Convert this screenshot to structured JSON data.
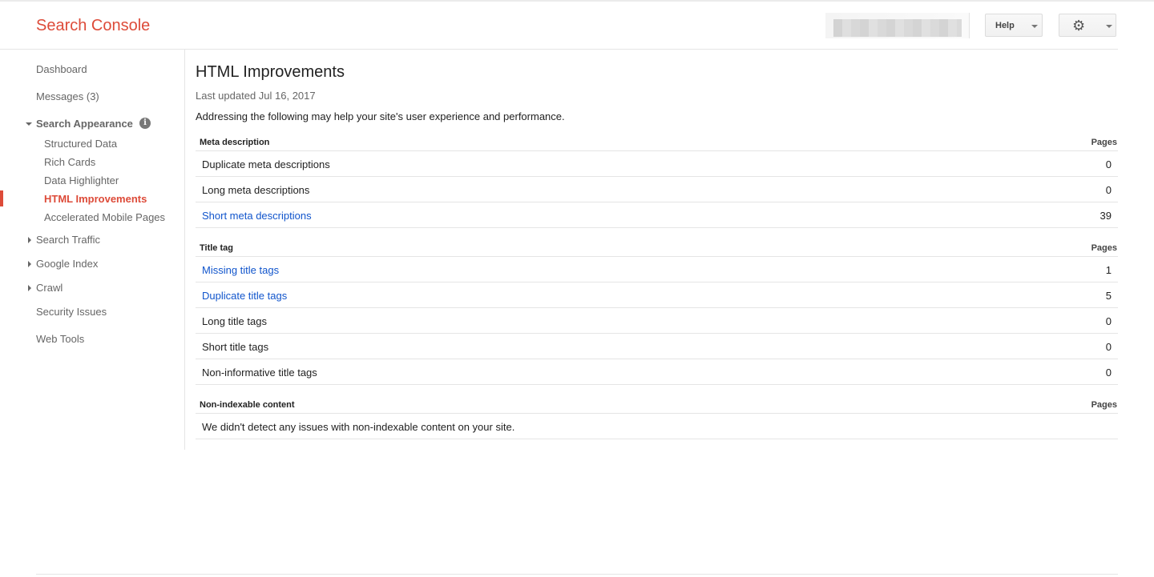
{
  "header": {
    "app_title": "Search Console",
    "account_label": "",
    "help_label": "Help",
    "settings_icon": "gear-icon"
  },
  "sidebar": {
    "items": [
      {
        "label": "Dashboard"
      },
      {
        "label": "Messages (3)"
      },
      {
        "label": "Search Appearance",
        "expanded": true,
        "info_icon": "info-icon"
      },
      {
        "label": "Structured Data"
      },
      {
        "label": "Rich Cards"
      },
      {
        "label": "Data Highlighter"
      },
      {
        "label": "HTML Improvements",
        "active": true
      },
      {
        "label": "Accelerated Mobile Pages"
      },
      {
        "label": "Search Traffic",
        "expanded": false
      },
      {
        "label": "Google Index",
        "expanded": false
      },
      {
        "label": "Crawl",
        "expanded": false
      },
      {
        "label": "Security Issues"
      },
      {
        "label": "Web Tools"
      }
    ],
    "active_color": "#dd4b39"
  },
  "main": {
    "title": "HTML Improvements",
    "last_updated": "Last updated Jul 16, 2017",
    "intro": "Addressing the following may help your site's user experience and performance.",
    "sections": [
      {
        "name": "Meta description",
        "pages_header": "Pages",
        "rows": [
          {
            "label": "Duplicate meta descriptions",
            "count": "0",
            "link": false
          },
          {
            "label": "Long meta descriptions",
            "count": "0",
            "link": false
          },
          {
            "label": "Short meta descriptions",
            "count": "39",
            "link": true
          }
        ]
      },
      {
        "name": "Title tag",
        "pages_header": "Pages",
        "rows": [
          {
            "label": "Missing title tags",
            "count": "1",
            "link": true
          },
          {
            "label": "Duplicate title tags",
            "count": "5",
            "link": true
          },
          {
            "label": "Long title tags",
            "count": "0",
            "link": false
          },
          {
            "label": "Short title tags",
            "count": "0",
            "link": false
          },
          {
            "label": "Non-informative title tags",
            "count": "0",
            "link": false
          }
        ]
      },
      {
        "name": "Non-indexable content",
        "pages_header": "Pages",
        "message": "We didn't detect any issues with non-indexable content on your site."
      }
    ],
    "link_color": "#1155cc"
  }
}
